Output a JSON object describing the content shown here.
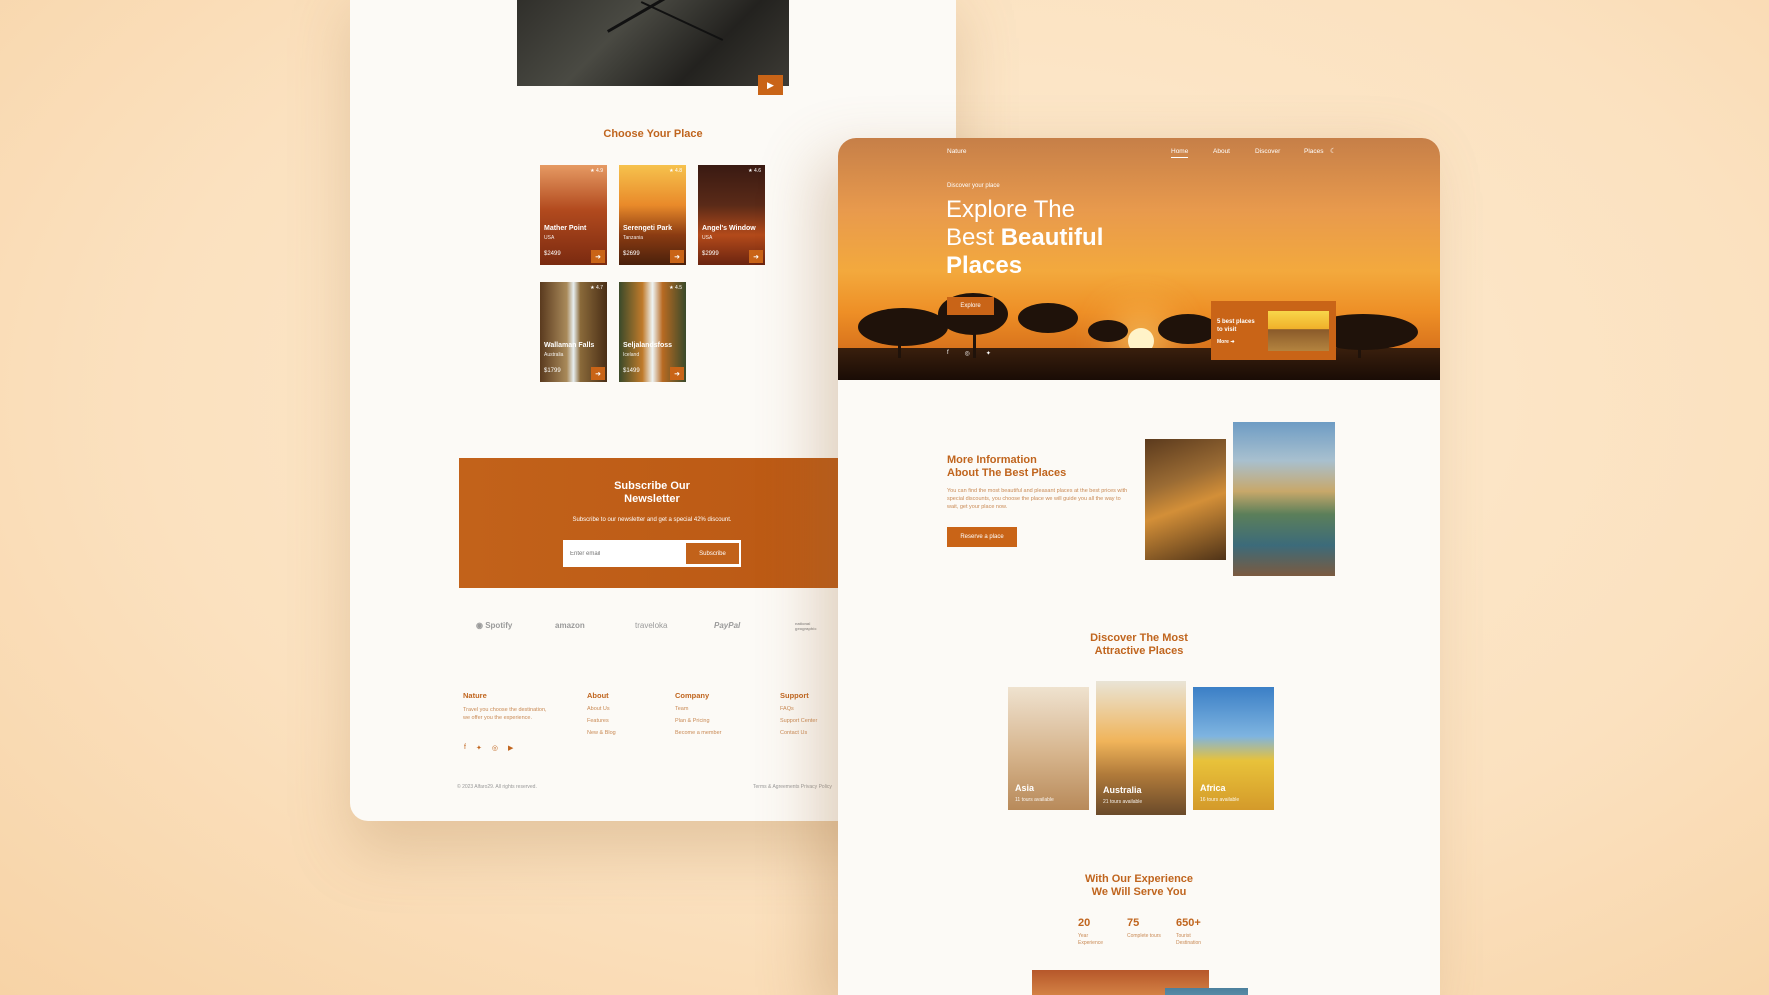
{
  "left_page": {
    "choose_title": "Choose Your Place",
    "places": [
      {
        "name": "Mather Point",
        "country": "USA",
        "price": "$2499",
        "rating": "4.9"
      },
      {
        "name": "Serengeti Park",
        "country": "Tanzania",
        "price": "$2699",
        "rating": "4.8"
      },
      {
        "name": "Angel's Window",
        "country": "USA",
        "price": "$2999",
        "rating": "4.6"
      },
      {
        "name": "Wallaman Falls",
        "country": "Australia",
        "price": "$1799",
        "rating": "4.7"
      },
      {
        "name": "Seljalandsfoss",
        "country": "Iceland",
        "price": "$1499",
        "rating": "4.5"
      }
    ],
    "newsletter": {
      "title_line1": "Subscribe Our",
      "title_line2": "Newsletter",
      "subtitle": "Subscribe to our newsletter and get a special 42% discount.",
      "placeholder": "Enter email",
      "button": "Subscribe"
    },
    "partner_logos": [
      "Spotify",
      "amazon",
      "traveloka",
      "PayPal",
      "national geographic"
    ],
    "footer": {
      "brand": "Nature",
      "brand_desc": "Travel you choose the destination, we offer you the experience.",
      "about": {
        "title": "About",
        "links": [
          "About Us",
          "Features",
          "New & Blog"
        ]
      },
      "company": {
        "title": "Company",
        "links": [
          "Team",
          "Plan & Pricing",
          "Become a member"
        ]
      },
      "support": {
        "title": "Support",
        "links": [
          "FAQs",
          "Support Center",
          "Contact Us"
        ]
      },
      "copyright": "© 2023 Alfaro29. All rights reserved.",
      "legal": "Terms & Agreements   Privacy Policy"
    }
  },
  "right_page": {
    "brand": "Nature",
    "nav": [
      "Home",
      "About",
      "Discover",
      "Places"
    ],
    "hero": {
      "kicker": "Discover your place",
      "title_line1": "Explore The",
      "title_line2_normal": "Best ",
      "title_line2_bold": "Beautiful",
      "title_line3": "Places",
      "button": "Explore",
      "promo_title": "5 best places to visit",
      "promo_more": "More"
    },
    "info": {
      "title_line1": "More Information",
      "title_line2": "About The Best Places",
      "body": "You can find the most beautiful and pleasant places at the best prices with special discounts, you choose the place we will guide you all the way to wait, get your place now.",
      "button": "Reserve a place"
    },
    "discover": {
      "title_line1": "Discover The Most",
      "title_line2": "Attractive Places",
      "destinations": [
        {
          "name": "Asia",
          "tours": "11 tours available"
        },
        {
          "name": "Australia",
          "tours": "21 tours available"
        },
        {
          "name": "Africa",
          "tours": "16 tours available"
        }
      ]
    },
    "experience": {
      "title_line1": "With Our Experience",
      "title_line2": "We Will Serve You",
      "stats": [
        {
          "value": "20",
          "label": "Year Experience"
        },
        {
          "value": "75",
          "label": "Complete tours"
        },
        {
          "value": "650+",
          "label": "Tourist Destination"
        }
      ]
    }
  },
  "colors": {
    "accent": "#c96417",
    "heading": "#c0651e",
    "background": "#fcfaf6"
  }
}
